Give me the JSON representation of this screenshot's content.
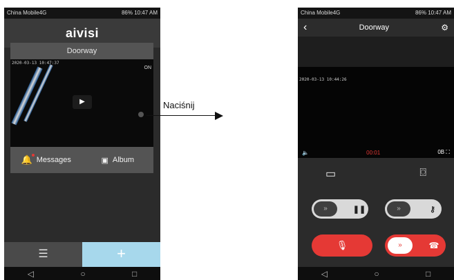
{
  "status_left": "China Mobile4G",
  "status_right": "86% 10:47 AM",
  "status_icons": [
    "sim-icon",
    "battery-icon"
  ],
  "phone1": {
    "app_title": "aivisi",
    "camera_name": "Doorway",
    "timestamp": "2020-03-13 10:47:37",
    "live_badge": "ON",
    "messages_label": "Messages",
    "album_label": "Album",
    "list_tab_icon": "list-icon",
    "add_tab_icon": "plus-icon"
  },
  "annotation": {
    "text": "Naciśnij"
  },
  "phone2": {
    "title": "Doorway",
    "timestamp": "2020-03-13 10:44:26",
    "timer": "00:01",
    "data_rate": "0B",
    "toggle_left_icons": [
      "chevrons-icon",
      "pause-icon"
    ],
    "toggle_right_icons": [
      "chevrons-icon",
      "key-icon"
    ],
    "hangup_icon": "phone-hangup-icon"
  },
  "navbar": [
    "back-icon",
    "home-icon",
    "recents-icon"
  ]
}
